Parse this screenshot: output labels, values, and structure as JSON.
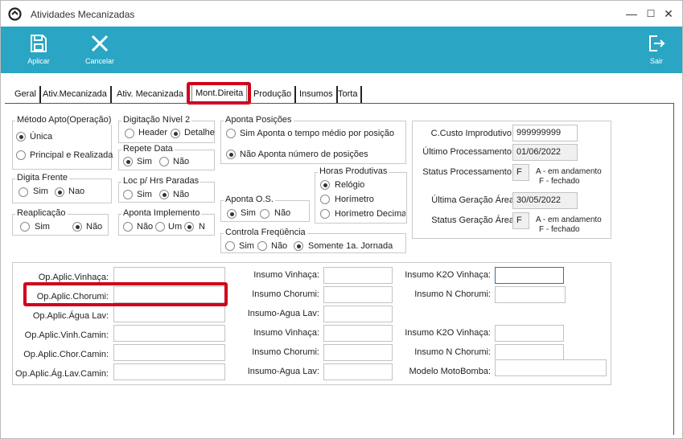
{
  "window": {
    "title": "Atividades Mecanizadas",
    "minimize": "—",
    "maximize": "☐",
    "close": "✕"
  },
  "toolbar": {
    "apply": "Aplicar",
    "cancel": "Cancelar",
    "exit": "Sair"
  },
  "tabs": [
    "Geral",
    "Ativ.Mecanizada",
    "Ativ. Mecanizada",
    "Mont.Direita",
    "Produção",
    "Insumos",
    "Torta"
  ],
  "metodo": {
    "caption": "Método Apto(Operação)",
    "opt1": "Única",
    "opt2": "Principal e Realizada",
    "selected": "Única"
  },
  "digitacao": {
    "caption": "Digitação Nível 2",
    "opt1": "Header",
    "opt2": "Detalhe",
    "selected": "Detalhe"
  },
  "repete": {
    "caption": "Repete Data",
    "opt1": "Sim",
    "opt2": "Não",
    "selected": "Sim"
  },
  "digita_frente": {
    "caption": "Digita Frente",
    "opt1": "Sim",
    "opt2": "Nao",
    "selected": "Nao"
  },
  "loc": {
    "caption": "Loc p/ Hrs Paradas",
    "opt1": "Sim",
    "opt2": "Não",
    "selected": "Não"
  },
  "reaplicacao": {
    "caption": "Reaplicação",
    "opt1": "Sim",
    "opt2": "Não",
    "selected": "Não"
  },
  "aponta_impl": {
    "caption": "Aponta Implemento",
    "opt1": "Não",
    "opt2": "Um",
    "opt3": "N",
    "selected": "Um"
  },
  "aponta_pos": {
    "caption": "Aponta Posições",
    "opt1": "Sim  Aponta o tempo médio por posição",
    "opt2": "Não  Aponta número de posições",
    "selected": "Não"
  },
  "aponta_os": {
    "caption": "Aponta O.S.",
    "opt1": "Sim",
    "opt2": "Não",
    "selected": "Sim"
  },
  "horas": {
    "caption": "Horas Produtivas",
    "opt1": "Relógio",
    "opt2": "Horímetro",
    "opt3": "Horímetro Decimal",
    "selected": "Relógio"
  },
  "controla": {
    "caption": "Controla Freqüência",
    "opt1": "Sim",
    "opt2": "Não",
    "opt3": "Somente 1a. Jornada",
    "selected": "Somente 1a. Jornada"
  },
  "status_box": {
    "ccusto_label": "C.Custo Improdutivo:",
    "ccusto": "999999999",
    "ult_proc_label": "Último Processamento:",
    "ult_proc": "01/06/2022",
    "status_proc_label": "Status Processamento:",
    "status_proc": "F",
    "status_legend1": "A - em andamento",
    "status_legend2": "F - fechado",
    "ult_ger_label": "Última Geração Área",
    "ult_ger": "30/05/2022",
    "status_ger_label": "Status Geração Área",
    "status_ger": "F",
    "ger_legend1": "A - em andamento",
    "ger_legend2": "F - fechado"
  },
  "lower": {
    "col1": [
      "Op.Aplic.Vinhaça:",
      "Op.Aplic.Chorumi:",
      "Op.Aplic.Água Lav:",
      "Op.Aplic.Vinh.Camin:",
      "Op.Aplic.Chor.Camin:",
      "Op.Aplic.Ág.Lav.Camin:"
    ],
    "col2": [
      "Insumo Vinhaça:",
      "Insumo Chorumi:",
      "Insumo-Agua Lav:",
      "Insumo Vinhaça:",
      "Insumo Chorumi:",
      "Insumo-Agua Lav:"
    ],
    "col3": [
      "Insumo K2O Vinhaça:",
      "Insumo N Chorumi:",
      "Insumo K2O Vinhaça:",
      "Insumo N Chorumi:",
      "Modelo MotoBomba:"
    ]
  },
  "colors": {
    "toolbar": "#2aa6c4",
    "highlight": "#d0021b"
  }
}
